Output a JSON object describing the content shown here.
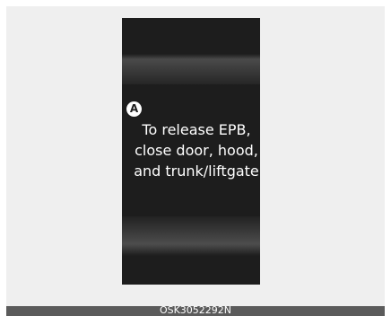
{
  "marker": {
    "label": "A"
  },
  "message": {
    "lines": [
      "To release EPB,",
      "close door, hood,",
      "and trunk/liftgate"
    ]
  },
  "caption": "OSK3052292N",
  "colors": {
    "display_background": "#1d1d1d",
    "text": "#ffffff",
    "page_background": "#efefef",
    "caption_bar": "#5b5b5b"
  }
}
